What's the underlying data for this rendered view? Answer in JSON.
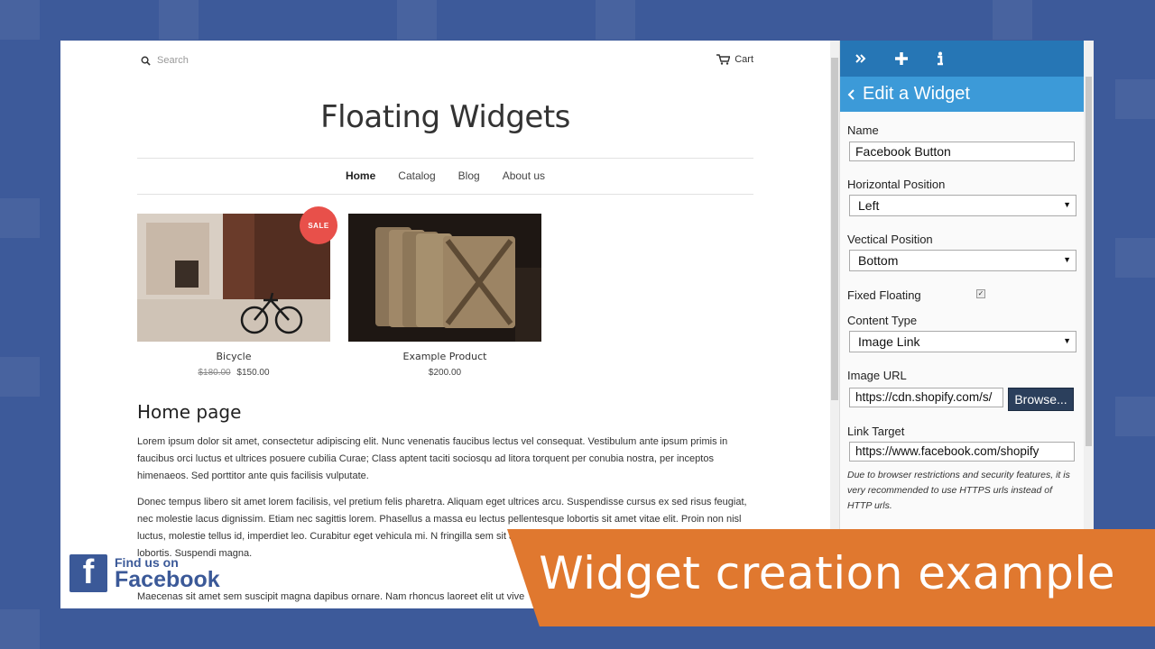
{
  "store": {
    "search_placeholder": "Search",
    "cart_label": "Cart",
    "site_title": "Floating Widgets",
    "nav": [
      "Home",
      "Catalog",
      "Blog",
      "About us"
    ],
    "products": [
      {
        "name": "Bicycle",
        "old_price": "$180.00",
        "price": "$150.00",
        "badge": "SALE"
      },
      {
        "name": "Example Product",
        "price": "$200.00"
      }
    ],
    "home_heading": "Home page",
    "paragraphs": [
      "Lorem ipsum dolor sit amet, consectetur adipiscing elit. Nunc venenatis faucibus lectus vel consequat. Vestibulum ante ipsum primis in faucibus orci luctus et ultrices posuere cubilia Curae; Class aptent taciti sociosqu ad litora torquent per conubia nostra, per inceptos himenaeos. Sed porttitor ante quis facilisis vulputate.",
      "Donec tempus libero sit amet lorem facilisis, vel pretium felis pharetra. Aliquam eget ultrices arcu. Suspendisse cursus ex sed risus feugiat, nec molestie lacus dignissim. Etiam nec sagittis lorem. Phasellus a massa eu lectus pellentesque lobortis sit amet vitae elit. Proin non nisl luctus, molestie tellus id, imperdiet leo. Curabitur eget vehicula mi. N fringilla sem sit amet mauris vehicula, consectetur tincidunt quam lobortis. Suspendi magna.",
      "Maecenas sit amet sem suscipit magna dapibus ornare. Nam rhoncus laoreet elit ut vive"
    ],
    "facebook_widget": {
      "line1": "Find us on",
      "line2": "Facebook"
    }
  },
  "panel": {
    "toolbar_icons": [
      "collapse-icon",
      "add-icon",
      "info-icon"
    ],
    "title": "Edit a Widget",
    "fields": {
      "name_label": "Name",
      "name_value": "Facebook Button",
      "hpos_label": "Horizontal Position",
      "hpos_value": "Left",
      "vpos_label": "Vectical Position",
      "vpos_value": "Bottom",
      "fixed_label": "Fixed Floating",
      "fixed_checked": true,
      "content_label": "Content Type",
      "content_value": "Image Link",
      "image_url_label": "Image URL",
      "image_url_value": "https://cdn.shopify.com/s/",
      "browse_label": "Browse...",
      "link_label": "Link Target",
      "link_value": "https://www.facebook.com/shopify",
      "note": "Due to browser restrictions and security features, it is very recommended to use HTTPS urls instead of HTTP urls."
    }
  },
  "banner": {
    "text": "Widget creation example",
    "color": "#e0782f"
  }
}
